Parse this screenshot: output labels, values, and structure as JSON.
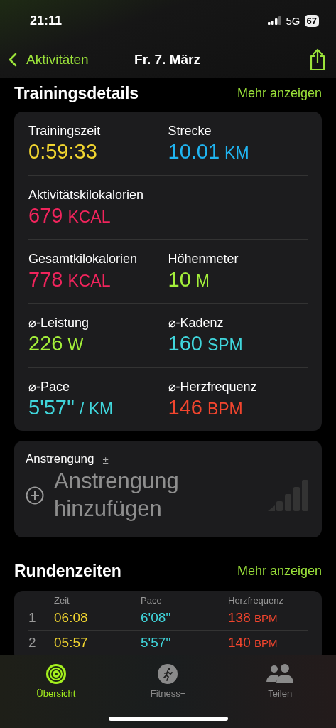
{
  "status_bar": {
    "time": "21:11",
    "network": "5G",
    "battery": "67"
  },
  "nav": {
    "back": "Aktivitäten",
    "title": "Fr. 7. März"
  },
  "details": {
    "title": "Trainingsdetails",
    "more": "Mehr anzeigen",
    "rows": [
      [
        {
          "label": "Trainingszeit",
          "value": "0:59:33",
          "color": "#f2d630"
        },
        {
          "label": "Strecke",
          "value": "10.01",
          "unit": "KM",
          "color": "#20b4f0"
        }
      ],
      [
        {
          "label": "Aktivitätskilokalorien",
          "value": "679",
          "unit": "KCAL",
          "color": "#f0245c"
        }
      ],
      [
        {
          "label": "Gesamtkilokalorien",
          "value": "778",
          "unit": "KCAL",
          "color": "#f0245c"
        },
        {
          "label": "Höhenmeter",
          "value": "10",
          "unit": "M",
          "color": "#a4ef3a"
        }
      ],
      [
        {
          "label": "⌀-Leistung",
          "value": "226",
          "unit": "W",
          "color": "#a4ef3a"
        },
        {
          "label": "⌀-Kadenz",
          "value": "160",
          "unit": "SPM",
          "color": "#40d6dc"
        }
      ],
      [
        {
          "label": "⌀-Pace",
          "value": "5'57''",
          "unit": "/ KM",
          "color": "#40d6dc"
        },
        {
          "label": "⌀-Herzfrequenz",
          "value": "146",
          "unit": "BPM",
          "color": "#f2452e"
        }
      ]
    ]
  },
  "effort": {
    "label": "Anstrengung",
    "sign": "±",
    "action": "Anstrengung hinzufügen"
  },
  "laps": {
    "title": "Rundenzeiten",
    "more": "Mehr anzeigen",
    "columns": [
      "Zeit",
      "Pace",
      "Herzfrequenz"
    ],
    "rows": [
      {
        "number": "1",
        "time": "06:08",
        "pace": "6'08''",
        "hr": "138",
        "unit": "BPM"
      },
      {
        "number": "2",
        "time": "05:57",
        "pace": "5'57''",
        "hr": "140",
        "unit": "BPM"
      }
    ]
  },
  "tabs": [
    {
      "label": "Übersicht",
      "selected": true,
      "kind": "rings"
    },
    {
      "label": "Fitness+",
      "selected": false,
      "kind": "runner"
    },
    {
      "label": "Teilen",
      "selected": false,
      "kind": "people"
    }
  ]
}
